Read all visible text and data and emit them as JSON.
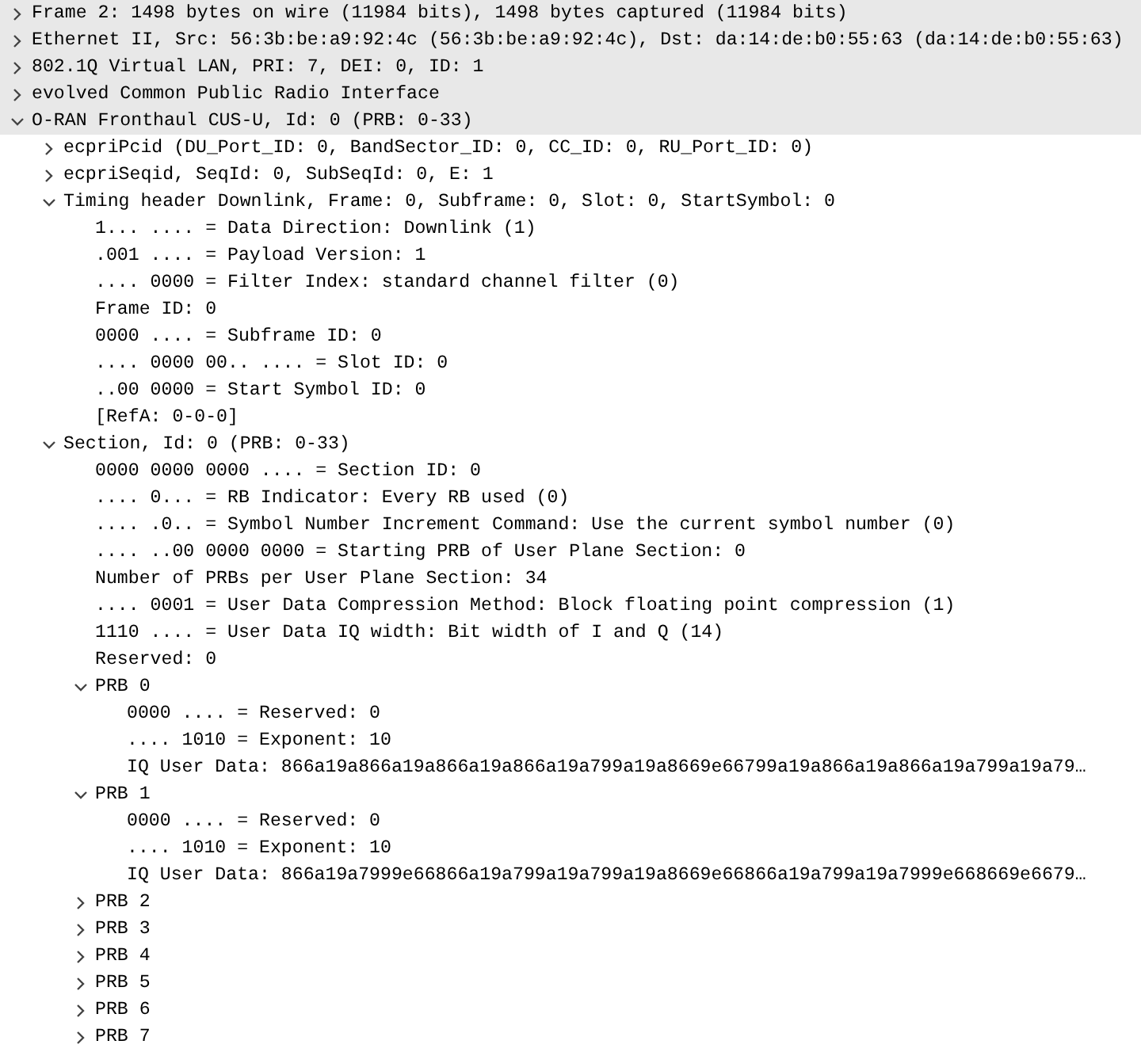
{
  "tree": [
    {
      "label": "Frame 2: 1498 bytes on wire (11984 bits), 1498 bytes captured (11984 bits)",
      "expanded": false
    },
    {
      "label": "Ethernet II, Src: 56:3b:be:a9:92:4c (56:3b:be:a9:92:4c), Dst: da:14:de:b0:55:63 (da:14:de:b0:55:63)",
      "expanded": false
    },
    {
      "label": "802.1Q Virtual LAN, PRI: 7, DEI: 0, ID: 1",
      "expanded": false
    },
    {
      "label": "evolved Common Public Radio Interface",
      "expanded": false
    },
    {
      "label": "O-RAN Fronthaul CUS-U, Id: 0 (PRB: 0-33)",
      "expanded": true,
      "children": [
        {
          "label": "ecpriPcid (DU_Port_ID: 0, BandSector_ID: 0, CC_ID: 0, RU_Port_ID: 0)",
          "expanded": false
        },
        {
          "label": "ecpriSeqid, SeqId: 0, SubSeqId: 0, E: 1",
          "expanded": false
        },
        {
          "label": "Timing header Downlink, Frame: 0, Subframe: 0, Slot: 0, StartSymbol: 0",
          "expanded": true,
          "children": [
            {
              "label": "1... .... = Data Direction: Downlink (1)"
            },
            {
              "label": ".001 .... = Payload Version: 1"
            },
            {
              "label": ".... 0000 = Filter Index: standard channel filter (0)"
            },
            {
              "label": "Frame ID: 0"
            },
            {
              "label": "0000 .... = Subframe ID: 0"
            },
            {
              "label": ".... 0000 00.. .... = Slot ID: 0"
            },
            {
              "label": "..00 0000 = Start Symbol ID: 0"
            },
            {
              "label": "[RefA: 0-0-0]"
            }
          ]
        },
        {
          "label": "Section, Id: 0 (PRB: 0-33)",
          "expanded": true,
          "children": [
            {
              "label": "0000 0000 0000 .... = Section ID: 0"
            },
            {
              "label": ".... 0... = RB Indicator: Every RB used (0)"
            },
            {
              "label": ".... .0.. = Symbol Number Increment Command: Use the current symbol number (0)"
            },
            {
              "label": ".... ..00 0000 0000 = Starting PRB of User Plane Section: 0"
            },
            {
              "label": "Number of PRBs per User Plane Section: 34"
            },
            {
              "label": ".... 0001 = User Data Compression Method: Block floating point compression (1)"
            },
            {
              "label": "1110 .... = User Data IQ width: Bit width of I and Q (14)"
            },
            {
              "label": "Reserved: 0"
            },
            {
              "label": "PRB 0",
              "expanded": true,
              "children": [
                {
                  "label": "0000 .... = Reserved: 0"
                },
                {
                  "label": ".... 1010 = Exponent: 10"
                },
                {
                  "label": "IQ User Data: 866a19a866a19a866a19a866a19a799a19a8669e66799a19a866a19a866a19a799a19a79…"
                }
              ]
            },
            {
              "label": "PRB 1",
              "expanded": true,
              "children": [
                {
                  "label": "0000 .... = Reserved: 0"
                },
                {
                  "label": ".... 1010 = Exponent: 10"
                },
                {
                  "label": "IQ User Data: 866a19a7999e66866a19a799a19a799a19a8669e66866a19a799a19a7999e668669e6679…"
                }
              ]
            },
            {
              "label": "PRB 2",
              "expanded": false
            },
            {
              "label": "PRB 3",
              "expanded": false
            },
            {
              "label": "PRB 4",
              "expanded": false
            },
            {
              "label": "PRB 5",
              "expanded": false
            },
            {
              "label": "PRB 6",
              "expanded": false
            },
            {
              "label": "PRB 7",
              "expanded": false
            }
          ]
        }
      ]
    }
  ]
}
